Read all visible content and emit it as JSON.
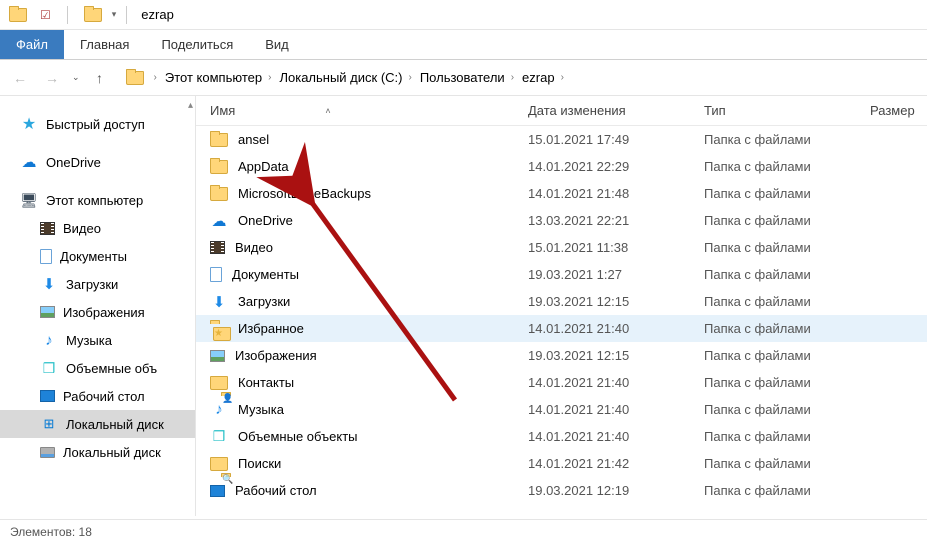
{
  "title": "ezrap",
  "ribbon": {
    "file": "Файл",
    "tabs": [
      "Главная",
      "Поделиться",
      "Вид"
    ]
  },
  "breadcrumb": [
    "Этот компьютер",
    "Локальный диск (C:)",
    "Пользователи",
    "ezrap"
  ],
  "tree": {
    "quick": "Быстрый доступ",
    "onedrive": "OneDrive",
    "pc": "Этот компьютер",
    "children": [
      "Видео",
      "Документы",
      "Загрузки",
      "Изображения",
      "Музыка",
      "Объемные объ",
      "Рабочий стол",
      "Локальный диск",
      "Локальный диск"
    ]
  },
  "columns": {
    "name": "Имя",
    "date": "Дата изменения",
    "type": "Тип",
    "size": "Размер"
  },
  "rows": [
    {
      "icon": "folder",
      "name": "ansel",
      "date": "15.01.2021 17:49",
      "type": "Папка с файлами"
    },
    {
      "icon": "folder",
      "name": "AppData",
      "date": "14.01.2021 22:29",
      "type": "Папка с файлами"
    },
    {
      "icon": "folder",
      "name": "MicrosoftEdgeBackups",
      "date": "14.01.2021 21:48",
      "type": "Папка с файлами"
    },
    {
      "icon": "cloud",
      "name": "OneDrive",
      "date": "13.03.2021 22:21",
      "type": "Папка с файлами"
    },
    {
      "icon": "video",
      "name": "Видео",
      "date": "15.01.2021 11:38",
      "type": "Папка с файлами"
    },
    {
      "icon": "doc",
      "name": "Документы",
      "date": "19.03.2021 1:27",
      "type": "Папка с файлами"
    },
    {
      "icon": "down",
      "name": "Загрузки",
      "date": "19.03.2021 12:15",
      "type": "Папка с файлами"
    },
    {
      "icon": "fav",
      "name": "Избранное",
      "date": "14.01.2021 21:40",
      "type": "Папка с файлами",
      "hl": true
    },
    {
      "icon": "img",
      "name": "Изображения",
      "date": "19.03.2021 12:15",
      "type": "Папка с файлами"
    },
    {
      "icon": "contact",
      "name": "Контакты",
      "date": "14.01.2021 21:40",
      "type": "Папка с файлами"
    },
    {
      "icon": "music",
      "name": "Музыка",
      "date": "14.01.2021 21:40",
      "type": "Папка с файлами"
    },
    {
      "icon": "obj",
      "name": "Объемные объекты",
      "date": "14.01.2021 21:40",
      "type": "Папка с файлами"
    },
    {
      "icon": "search",
      "name": "Поиски",
      "date": "14.01.2021 21:42",
      "type": "Папка с файлами"
    },
    {
      "icon": "desk",
      "name": "Рабочий стол",
      "date": "19.03.2021 12:19",
      "type": "Папка с файлами"
    }
  ],
  "status": {
    "label": "Элементов:",
    "count": "18"
  }
}
